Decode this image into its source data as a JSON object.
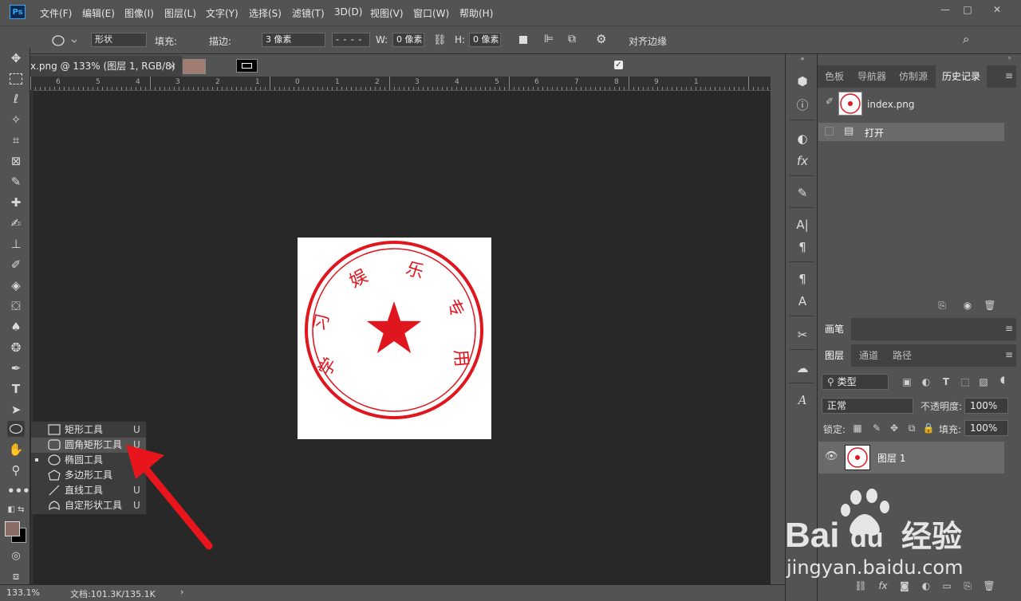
{
  "app": {
    "logo": "Ps"
  },
  "menu": [
    "文件(F)",
    "编辑(E)",
    "图像(I)",
    "图层(L)",
    "文字(Y)",
    "选择(S)",
    "滤镜(T)",
    "3D(D)",
    "视图(V)",
    "窗口(W)",
    "帮助(H)"
  ],
  "window_controls": [
    "—",
    "□",
    "✕"
  ],
  "options": {
    "mode": "形状",
    "fill_label": "填充:",
    "fill_color": "#a07c72",
    "stroke_label": "描边:",
    "stroke_width": "3 像素",
    "w_label": "W:",
    "w_value": "0 像素",
    "h_label": "H:",
    "h_value": "0 像素",
    "align_edges": "对齐边缘"
  },
  "document": {
    "tab_title": "x.png @ 133% (图层 1, RGB/8)",
    "close": "×",
    "ruler_numbers": [
      "6",
      "5",
      "4",
      "3",
      "2",
      "1",
      "0",
      "1",
      "2",
      "3",
      "4",
      "5",
      "6",
      "7",
      "8",
      "9",
      "1"
    ],
    "zoom": "133.1%",
    "status": "文档:101.3K/135.1K",
    "stamp": {
      "chars": [
        "学",
        "习",
        "娱",
        "乐",
        "专",
        "用"
      ],
      "color": "#e0161e"
    }
  },
  "shape_flyout": {
    "items": [
      {
        "label": "矩形工具",
        "key": "U",
        "icon": "rectangle-icon"
      },
      {
        "label": "圆角矩形工具",
        "key": "U",
        "icon": "rounded-rectangle-icon",
        "highlighted": true
      },
      {
        "label": "椭圆工具",
        "key": "",
        "icon": "ellipse-icon",
        "selected": true
      },
      {
        "label": "多边形工具",
        "key": "",
        "icon": "polygon-icon"
      },
      {
        "label": "直线工具",
        "key": "U",
        "icon": "line-icon"
      },
      {
        "label": "自定形状工具",
        "key": "U",
        "icon": "custom-shape-icon"
      }
    ]
  },
  "colors": {
    "foreground": "#8a6e66",
    "background": "#000000",
    "accent_red": "#e8161c"
  },
  "history_panel": {
    "tabs": [
      "色板",
      "导航器",
      "仿制源",
      "历史记录"
    ],
    "active_tab": "历史记录",
    "snapshot": "index.png",
    "steps": [
      "打开"
    ]
  },
  "brush_panel": {
    "tab": "画笔"
  },
  "layers_panel": {
    "tabs": [
      "图层",
      "通道",
      "路径"
    ],
    "filter": "类型",
    "blend_mode": "正常",
    "opacity_label": "不透明度:",
    "opacity": "100%",
    "lock_label": "锁定:",
    "fill_label": "填充:",
    "fill": "100%",
    "layers": [
      {
        "name": "图层 1",
        "visible": true
      }
    ]
  },
  "watermark": {
    "brand": "Bai",
    "brand2": "du",
    "cn": "经验",
    "url": "jingyan.baidu.com"
  }
}
